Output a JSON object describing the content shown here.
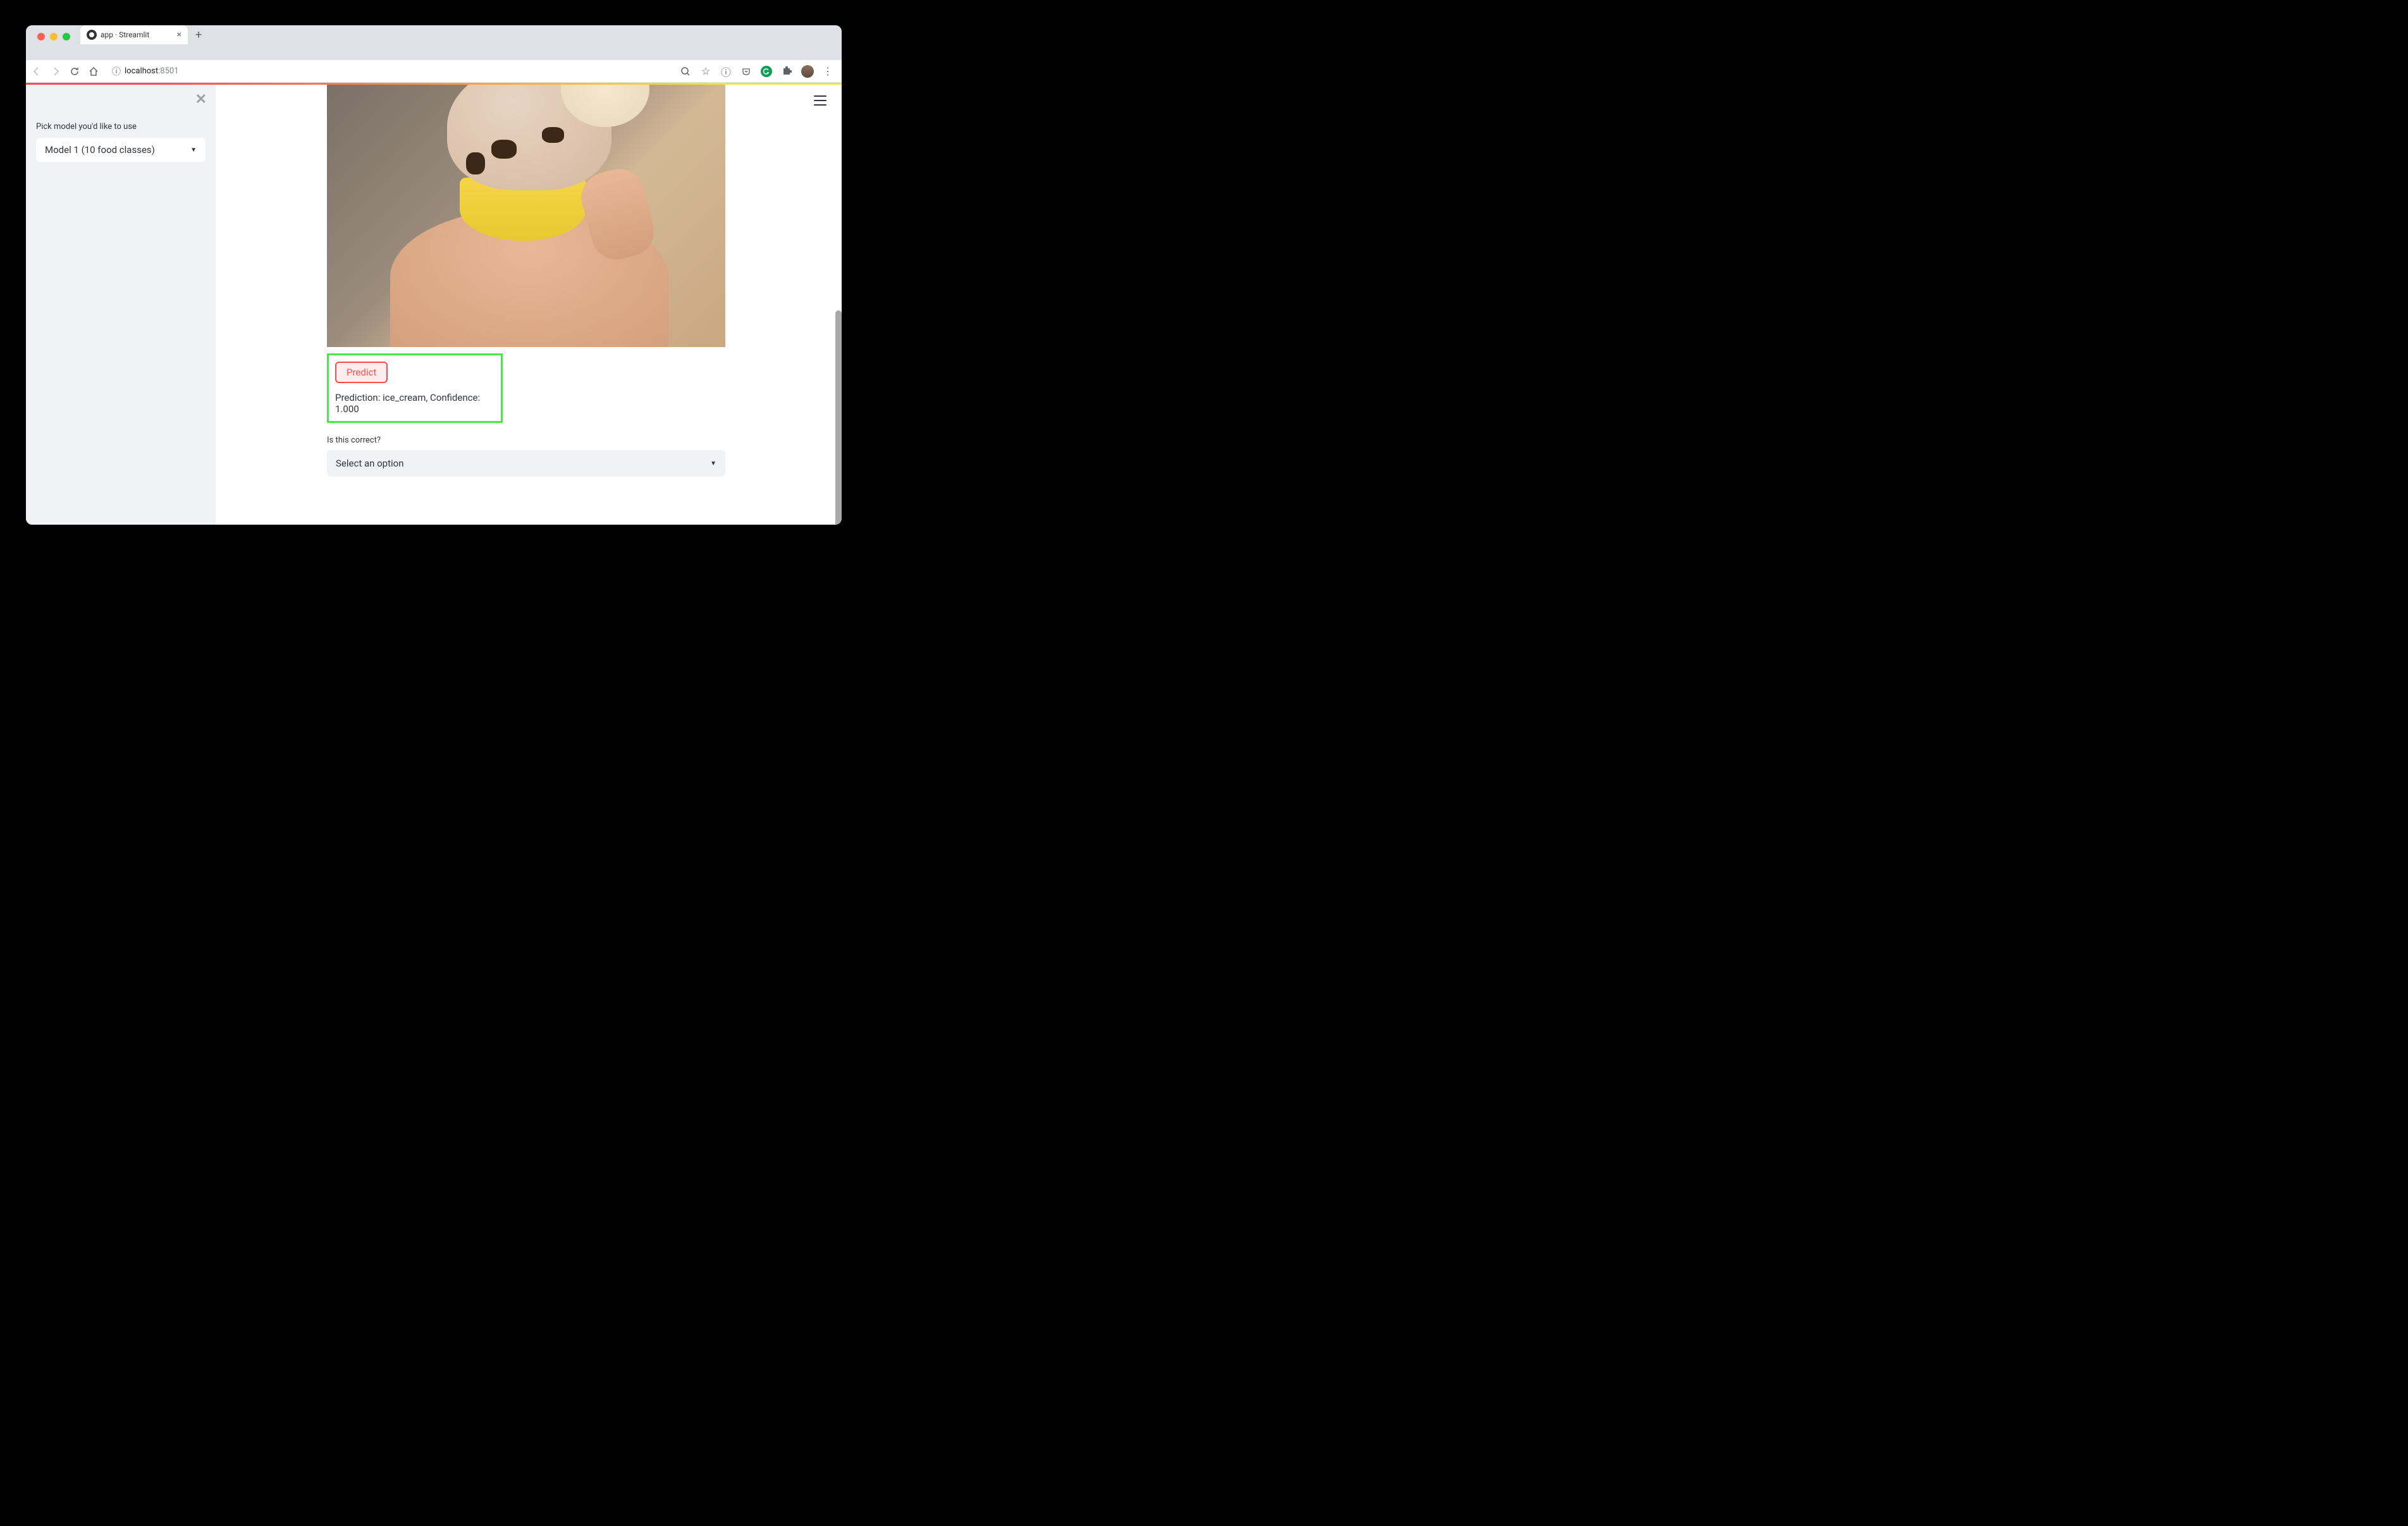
{
  "browser": {
    "tab_title": "app · Streamlit",
    "url_host": "localhost",
    "url_port": ":8501"
  },
  "sidebar": {
    "model_label": "Pick model you'd like to use",
    "model_selected": "Model 1 (10 food classes)"
  },
  "main": {
    "predict_button": "Predict",
    "prediction_text": "Prediction: ice_cream, Confidence: 1.000",
    "feedback_label": "Is this correct?",
    "feedback_selected": "Select an option"
  }
}
